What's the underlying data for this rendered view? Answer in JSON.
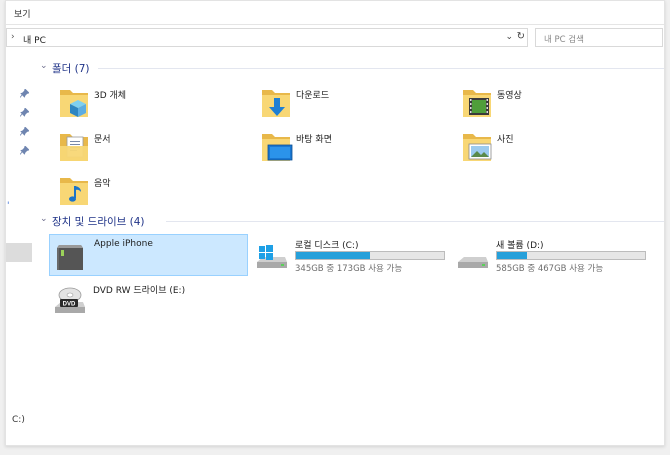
{
  "ribbon": {
    "tab_label": "보기"
  },
  "address": {
    "chevron": "›",
    "path": "내 PC",
    "dropdown_glyph": "⌄",
    "refresh_glyph": "↻"
  },
  "search": {
    "placeholder": "내 PC 검색"
  },
  "nav": {
    "pin_glyph": "📌",
    "fragment_left": "'",
    "fragment_bottom": "C:)"
  },
  "groups": {
    "folders": {
      "arrow": "⌄",
      "title": "폴더 (7)"
    },
    "drives": {
      "arrow": "⌄",
      "title": "장치 및 드라이브 (4)"
    }
  },
  "folders": [
    {
      "label": "3D 개체",
      "icon": "3d-objects-folder-icon"
    },
    {
      "label": "다운로드",
      "icon": "downloads-folder-icon"
    },
    {
      "label": "동영상",
      "icon": "videos-folder-icon"
    },
    {
      "label": "문서",
      "icon": "documents-folder-icon"
    },
    {
      "label": "바탕 화면",
      "icon": "desktop-folder-icon"
    },
    {
      "label": "사진",
      "icon": "pictures-folder-icon"
    },
    {
      "label": "음악",
      "icon": "music-folder-icon"
    }
  ],
  "drives": [
    {
      "name": "Apple iPhone",
      "icon": "phone-device-icon"
    },
    {
      "name": "로컬 디스크 (C:)",
      "free_text": "345GB 중 173GB 사용 가능",
      "used_fraction": 0.5,
      "icon": "windows-drive-icon"
    },
    {
      "name": "새 볼륨 (D:)",
      "free_text": "585GB 중 467GB 사용 가능",
      "used_fraction": 0.2,
      "icon": "hard-drive-icon"
    },
    {
      "name": "DVD RW 드라이브 (E:)",
      "icon": "dvd-drive-icon",
      "badge": "DVD"
    }
  ],
  "colors": {
    "folder": "#f8d775",
    "accent": "#26a0da",
    "selection": "#cce8ff",
    "group_title": "#1e3287"
  }
}
